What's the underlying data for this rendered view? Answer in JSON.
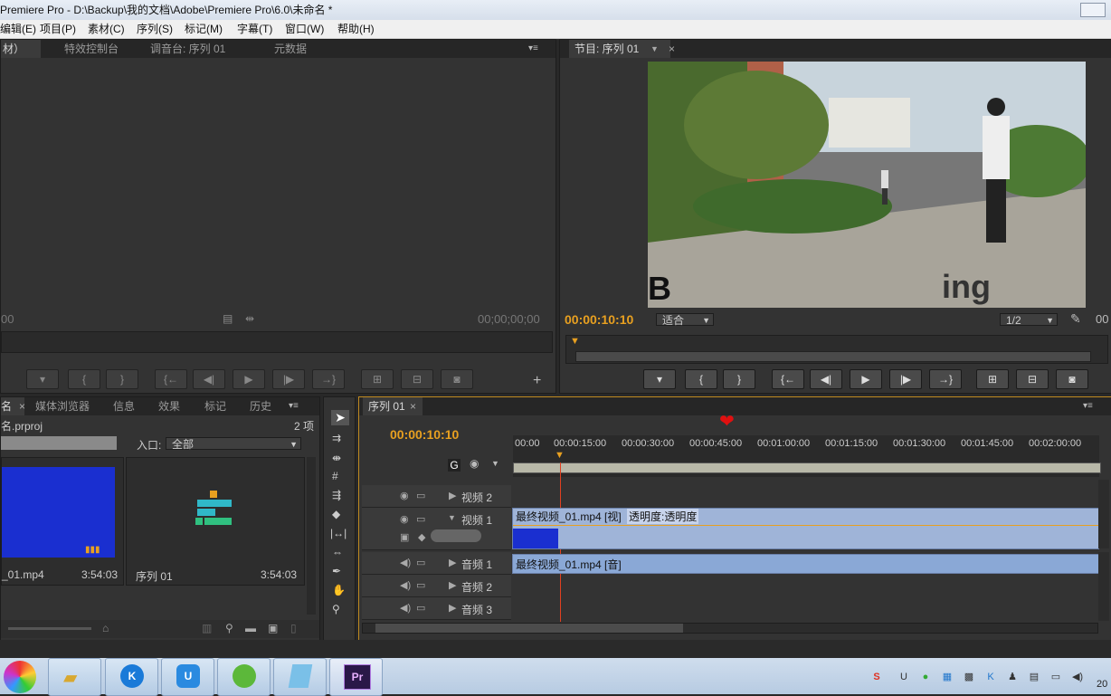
{
  "window": {
    "title": "Premiere Pro - D:\\Backup\\我的文档\\Adobe\\Premiere Pro\\6.0\\未命名 *"
  },
  "menu": [
    "编辑(E)",
    "项目(P)",
    "素材(C)",
    "序列(S)",
    "标记(M)",
    "字幕(T)",
    "窗口(W)",
    "帮助(H)"
  ],
  "source_panel": {
    "tabs": [
      "材）",
      "特效控制台",
      "调音台: 序列 01",
      "元数据"
    ],
    "timecode_left": "00",
    "timecode_right": "00;00;00;00"
  },
  "program_panel": {
    "tab": "节目: 序列 01",
    "timecode": "00:00:10:10",
    "fit_label": "适合",
    "resolution": "1/2",
    "timecode_right": "00",
    "overlay_left": "B",
    "overlay_right": "ing"
  },
  "project_panel": {
    "tabs": [
      "名",
      "媒体浏览器",
      "信息",
      "效果",
      "标记",
      "历史"
    ],
    "project_file": "名.prproj",
    "item_count": "2 项",
    "in_label": "入口:",
    "in_value": "全部",
    "items": [
      {
        "name": "_01.mp4",
        "duration": "3:54:03"
      },
      {
        "name": "序列 01",
        "duration": "3:54:03"
      }
    ]
  },
  "timeline": {
    "tab": "序列 01",
    "timecode": "00:00:10:10",
    "ruler": [
      "00:00",
      "00:00:15:00",
      "00:00:30:00",
      "00:00:45:00",
      "00:01:00:00",
      "00:01:15:00",
      "00:01:30:00",
      "00:01:45:00",
      "00:02:00:00"
    ],
    "tracks": {
      "video2": "视频 2",
      "video1": "视频 1",
      "audio1": "音频 1",
      "audio2": "音频 2",
      "audio3": "音频 3"
    },
    "video_clip_label": "最终视频_01.mp4 [视]",
    "video_clip_effect": "透明度:透明度",
    "audio_clip_label": "最终视频_01.mp4 [音]"
  },
  "colors": {
    "accent": "#e8a020",
    "clip_video": "#9fb4d8",
    "clip_audio": "#8aa8d6",
    "panel_bg": "#333333"
  },
  "taskbar": {
    "clock": "20"
  }
}
